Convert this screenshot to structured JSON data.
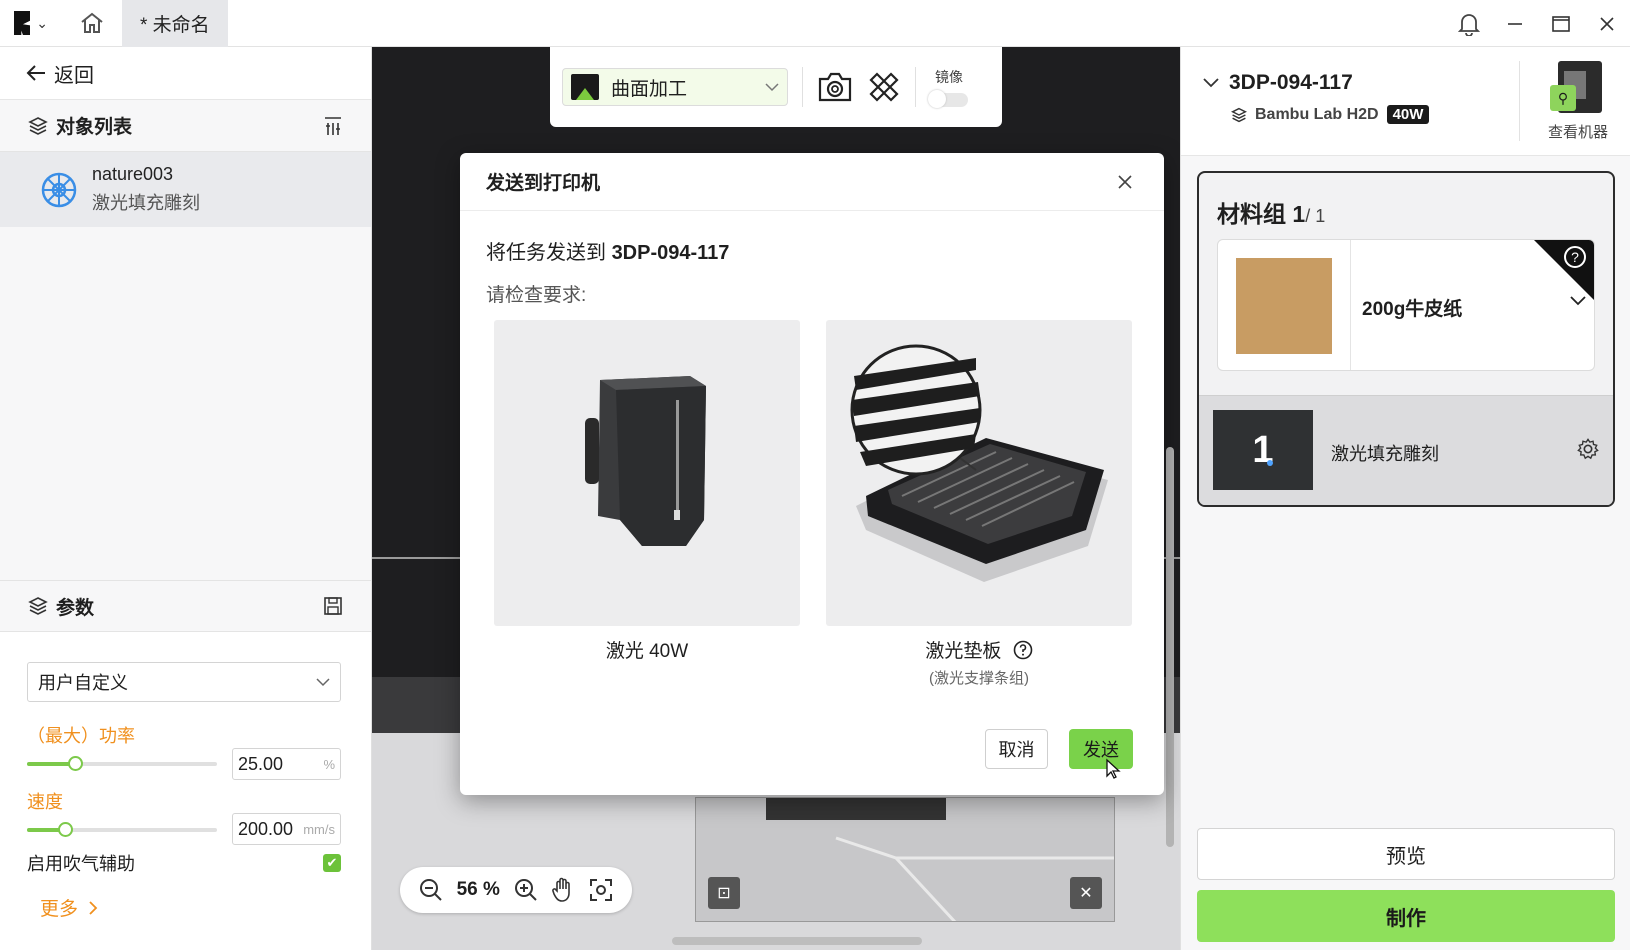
{
  "titlebar": {
    "tab_label": "* 未命名"
  },
  "left": {
    "back_label": "返回",
    "objects_title": "对象列表",
    "object": {
      "name": "nature003",
      "type": "激光填充雕刻"
    },
    "params_title": "参数",
    "preset": "用户自定义",
    "power_label": "（最大）功率",
    "power_value": "25.00",
    "power_unit": "%",
    "power_fraction": 0.25,
    "speed_label": "速度",
    "speed_value": "200.00",
    "speed_unit": "mm/s",
    "speed_fraction": 0.2,
    "air_assist_label": "启用吹气辅助",
    "air_assist_checked": true,
    "more_label": "更多"
  },
  "canvas": {
    "mode_label": "曲面加工",
    "mirror_label": "镜像",
    "zoom_label": "56 %"
  },
  "modal": {
    "title": "发送到打印机",
    "send_to_prefix": "将任务发送到",
    "send_to_target": "3DP-094-117",
    "check_label": "请检查要求:",
    "req1_label": "激光 40W",
    "req2_label": "激光垫板",
    "req2_sub": "(激光支撑条组)",
    "cancel_label": "取消",
    "send_label": "发送"
  },
  "right": {
    "printer_name": "3DP-094-117",
    "printer_model": "Bambu Lab H2D",
    "laser_badge": "40W",
    "view_machine_label": "查看机器",
    "material_group_label": "材料组 1",
    "material_group_total": "/ 1",
    "material_name": "200g牛皮纸",
    "material_color": "#c89c63",
    "layer_number": "1",
    "layer_name": "激光填充雕刻",
    "preview_label": "预览",
    "make_label": "制作"
  },
  "colors": {
    "accent_green": "#7ad24a",
    "label_orange": "#f0901e"
  }
}
